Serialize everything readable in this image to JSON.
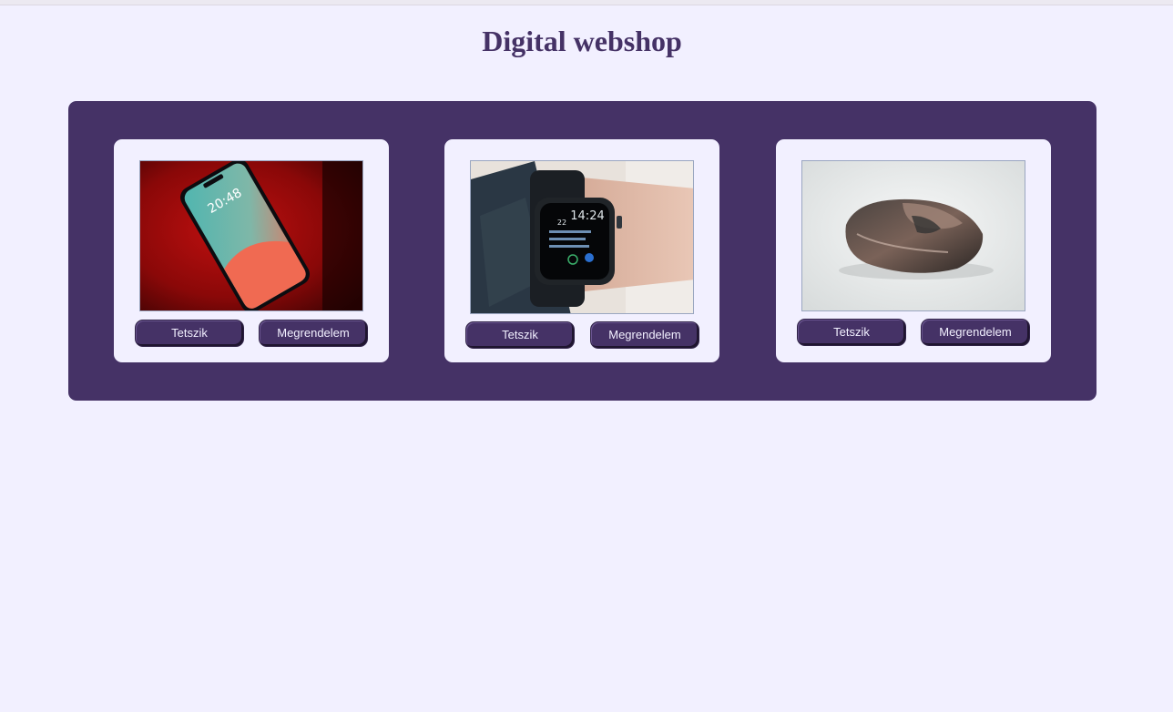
{
  "page": {
    "title": "Digital webshop"
  },
  "colors": {
    "background": "#f2f0ff",
    "accent": "#453266",
    "button_text": "#f2f0ff"
  },
  "products": [
    {
      "image_icon": "smartphone-photo",
      "like_label": "Tetszik",
      "order_label": "Megrendelem"
    },
    {
      "image_icon": "smartwatch-photo",
      "like_label": "Tetszik",
      "order_label": "Megrendelem"
    },
    {
      "image_icon": "computer-mouse-photo",
      "like_label": "Tetszik",
      "order_label": "Megrendelem"
    }
  ]
}
